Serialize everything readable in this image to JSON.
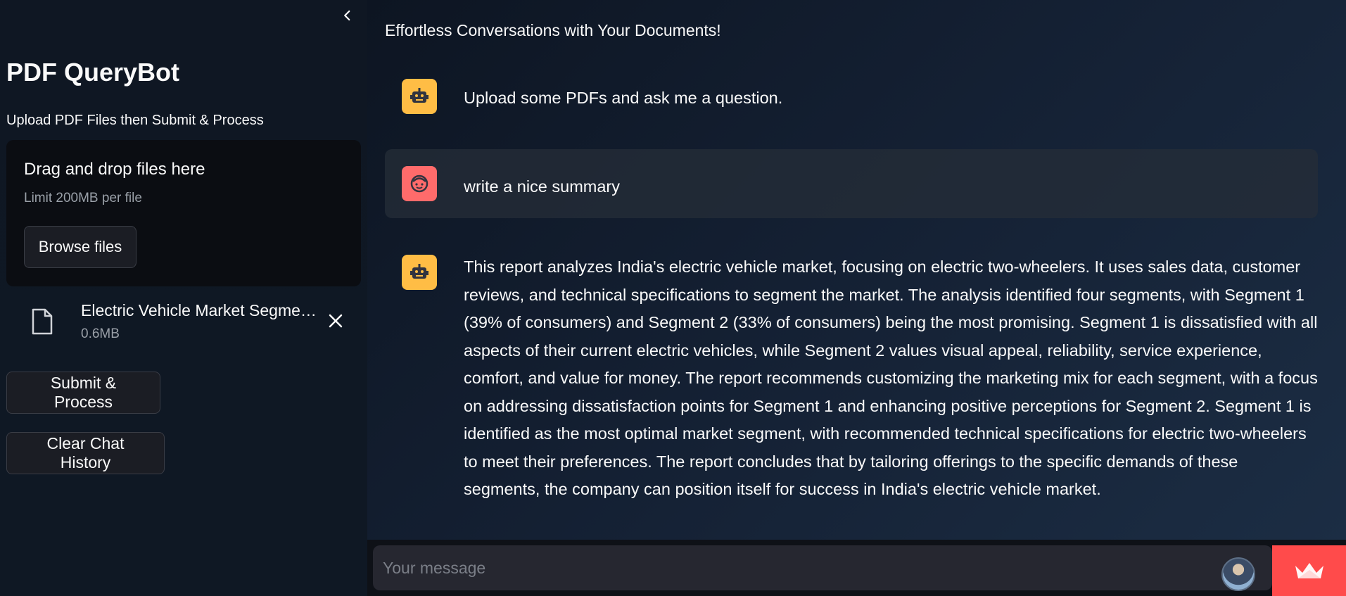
{
  "sidebar": {
    "title": "PDF QueryBot",
    "subtitle": "Upload PDF Files then Submit & Process",
    "uploader": {
      "drag_text": "Drag and drop files here",
      "limit_text": "Limit 200MB per file",
      "browse_label": "Browse files"
    },
    "file": {
      "name": "Electric Vehicle Market Segmentation Analysis.pdf",
      "size": "0.6MB"
    },
    "submit_label": "Submit & Process",
    "clear_label": "Clear Chat History"
  },
  "main": {
    "title": "Effortless Conversations with Your Documents!",
    "messages": [
      {
        "role": "assistant",
        "text": "Upload some PDFs and ask me a question."
      },
      {
        "role": "user",
        "text": "write a nice summary"
      },
      {
        "role": "assistant",
        "text": "This report analyzes India's electric vehicle market, focusing on electric two-wheelers. It uses sales data, customer reviews, and technical specifications to segment the market. The analysis identified four segments, with Segment 1 (39% of consumers) and Segment 2 (33% of consumers) being the most promising. Segment 1 is dissatisfied with all aspects of their current electric vehicles, while Segment 2 values visual appeal, reliability, service experience, comfort, and value for money. The report recommends customizing the marketing mix for each segment, with a focus on addressing dissatisfaction points for Segment 1 and enhancing positive perceptions for Segment 2. Segment 1 is identified as the most optimal market segment, with recommended technical specifications for electric two-wheelers to meet their preferences. The report concludes that by tailoring offerings to the specific demands of these segments, the company can position itself for success in India's electric vehicle market."
      }
    ],
    "input": {
      "placeholder": "Your message",
      "value": ""
    }
  },
  "colors": {
    "accent": "#ff4b4b",
    "bot_avatar": "#ffbd45",
    "user_avatar": "#ff6b6b"
  },
  "icons": {
    "collapse": "chevron-left-icon",
    "file": "file-icon",
    "remove": "close-icon",
    "bot": "robot-icon",
    "user": "user-face-icon",
    "deploy": "streamlit-crown-icon"
  }
}
